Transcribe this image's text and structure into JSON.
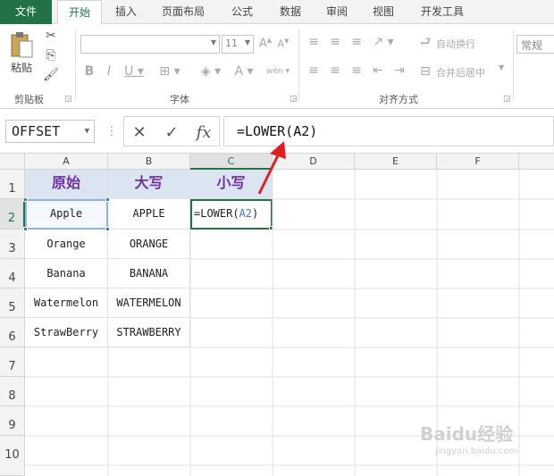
{
  "tabs": [
    {
      "label": "文件"
    },
    {
      "label": "开始"
    },
    {
      "label": "插入"
    },
    {
      "label": "页面布局"
    },
    {
      "label": "公式"
    },
    {
      "label": "数据"
    },
    {
      "label": "审阅"
    },
    {
      "label": "视图"
    },
    {
      "label": "开发工具"
    }
  ],
  "ribbon": {
    "clipboard": {
      "paste_label": "粘贴",
      "group_label": "剪贴板"
    },
    "font": {
      "size_value": "11",
      "group_label": "字体"
    },
    "alignment": {
      "wrap_label": "自动换行",
      "merge_label": "合并后居中",
      "group_label": "对齐方式"
    },
    "number": {
      "format_value": "常规"
    }
  },
  "formula_bar": {
    "name_box": "OFFSET",
    "formula": "=LOWER(A2)"
  },
  "columns": [
    "A",
    "B",
    "C",
    "D",
    "E",
    "F"
  ],
  "rows": [
    "1",
    "2",
    "3",
    "4",
    "5",
    "6",
    "7",
    "8",
    "9",
    "10"
  ],
  "header_row": {
    "a": "原始",
    "b": "大写",
    "c": "小写"
  },
  "data_rows": [
    {
      "a": "Apple",
      "b": "APPLE"
    },
    {
      "a": "Orange",
      "b": "ORANGE"
    },
    {
      "a": "Banana",
      "b": "BANANA"
    },
    {
      "a": "Watermelon",
      "b": "WATERMELON"
    },
    {
      "a": "StrawBerry",
      "b": "STRAWBERRY"
    }
  ],
  "active_cell": {
    "func": "=LOWER(",
    "ref": "A2",
    "close": ")"
  },
  "watermark": {
    "line1": "Baidu经验",
    "line2": "jingyan.baidu.com"
  },
  "colors": {
    "excel_green": "#217346",
    "header_fill": "#dbe5f1",
    "header_text": "#7030a0",
    "arrow": "#e02020"
  }
}
